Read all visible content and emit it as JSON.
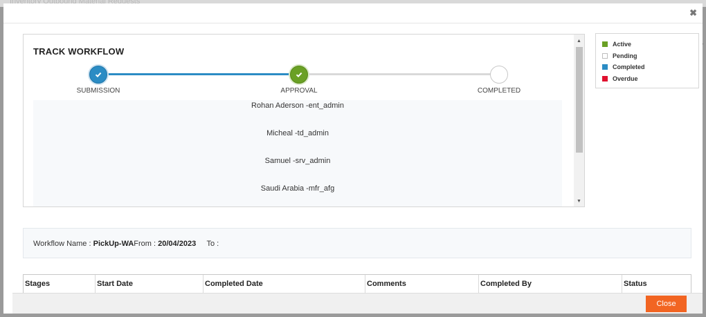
{
  "background": {
    "title": "Inventory Outbound Material Requests"
  },
  "modal": {
    "close_glyph": "✖"
  },
  "workflow": {
    "title": "TRACK WORKFLOW",
    "steps": [
      {
        "label": "SUBMISSION",
        "status": "completed"
      },
      {
        "label": "APPROVAL",
        "status": "active"
      },
      {
        "label": "COMPLETED",
        "status": "pending"
      }
    ],
    "approvers": [
      "Rohan Aderson -ent_admin",
      "Micheal -td_admin",
      "Samuel -srv_admin",
      "Saudi Arabia -mfr_afg"
    ]
  },
  "legend": [
    {
      "label": "Active",
      "color": "#6aa025"
    },
    {
      "label": "Pending",
      "color": "#ffffff"
    },
    {
      "label": "Completed",
      "color": "#2b8cc4"
    },
    {
      "label": "Overdue",
      "color": "#e0102f"
    }
  ],
  "info": {
    "workflow_name_label": "Workflow Name :",
    "workflow_name_value": "PickUp-WA",
    "from_label": "From :",
    "from_value": "20/04/2023",
    "to_label": "To :"
  },
  "table": {
    "columns": [
      "Stages",
      "Start Date",
      "Completed Date",
      "Comments",
      "Completed By",
      "Status"
    ]
  },
  "footer": {
    "close_label": "Close"
  },
  "edge_glyph": "›"
}
